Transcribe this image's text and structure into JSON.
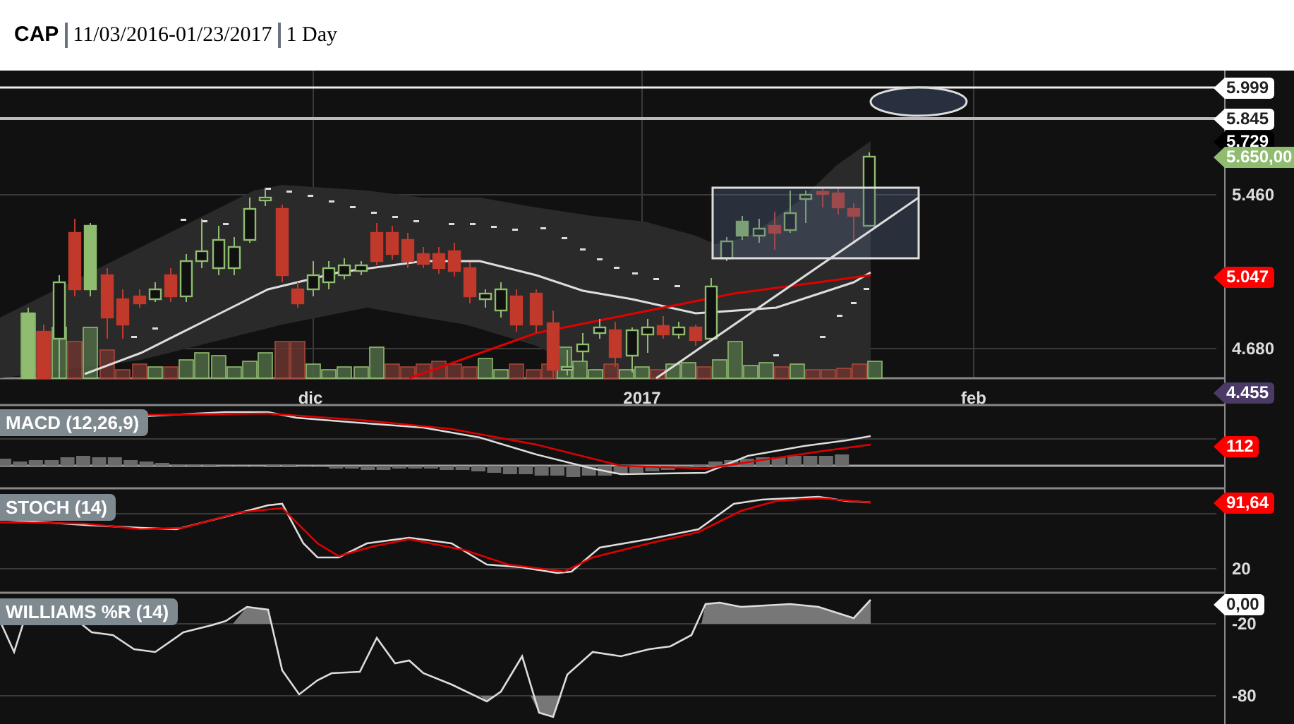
{
  "header": {
    "symbol": "CAP",
    "range": "11/03/2016-01/23/2017",
    "interval": "1 Day"
  },
  "price_panel": {
    "axis_labels": [
      "5.460",
      "4.680"
    ],
    "tags": [
      {
        "text": "5.999",
        "kind": "line"
      },
      {
        "text": "5.845",
        "kind": "line"
      },
      {
        "text": "5.729",
        "kind": "high"
      },
      {
        "text": "5.650,00",
        "kind": "last"
      },
      {
        "text": "5.047",
        "kind": "average"
      },
      {
        "text": "4.455",
        "kind": "low"
      }
    ]
  },
  "x_axis": [
    "dic",
    "2017",
    "feb"
  ],
  "indicators": [
    {
      "title": "MACD (12,26,9)",
      "tags": [
        {
          "text": "112",
          "kind": "average"
        }
      ]
    },
    {
      "title": "STOCH (14)",
      "axis_labels": [
        "20"
      ],
      "tags": [
        {
          "text": "91,64",
          "kind": "average"
        }
      ]
    },
    {
      "title": "WILLIAMS %R (14)",
      "axis_labels": [
        "-20",
        "-80"
      ],
      "tags": [
        {
          "text": "0,00",
          "kind": "line"
        }
      ]
    }
  ]
}
